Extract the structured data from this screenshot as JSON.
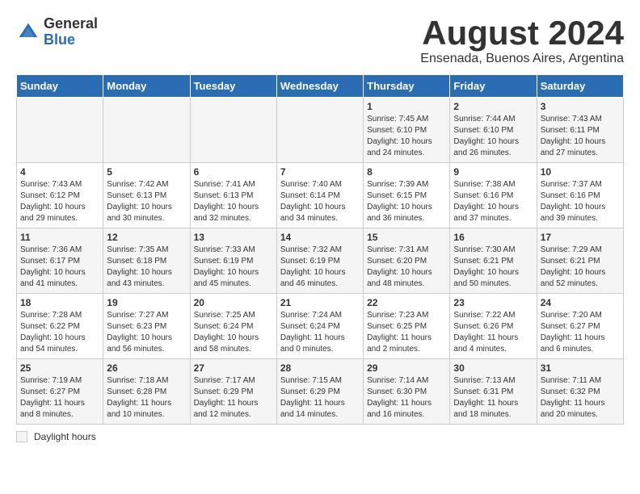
{
  "header": {
    "logo_general": "General",
    "logo_blue": "Blue",
    "month_title": "August 2024",
    "subtitle": "Ensenada, Buenos Aires, Argentina"
  },
  "days_of_week": [
    "Sunday",
    "Monday",
    "Tuesday",
    "Wednesday",
    "Thursday",
    "Friday",
    "Saturday"
  ],
  "weeks": [
    [
      {
        "day": "",
        "content": ""
      },
      {
        "day": "",
        "content": ""
      },
      {
        "day": "",
        "content": ""
      },
      {
        "day": "",
        "content": ""
      },
      {
        "day": "1",
        "content": "Sunrise: 7:45 AM\nSunset: 6:10 PM\nDaylight: 10 hours and 24 minutes."
      },
      {
        "day": "2",
        "content": "Sunrise: 7:44 AM\nSunset: 6:10 PM\nDaylight: 10 hours and 26 minutes."
      },
      {
        "day": "3",
        "content": "Sunrise: 7:43 AM\nSunset: 6:11 PM\nDaylight: 10 hours and 27 minutes."
      }
    ],
    [
      {
        "day": "4",
        "content": "Sunrise: 7:43 AM\nSunset: 6:12 PM\nDaylight: 10 hours and 29 minutes."
      },
      {
        "day": "5",
        "content": "Sunrise: 7:42 AM\nSunset: 6:13 PM\nDaylight: 10 hours and 30 minutes."
      },
      {
        "day": "6",
        "content": "Sunrise: 7:41 AM\nSunset: 6:13 PM\nDaylight: 10 hours and 32 minutes."
      },
      {
        "day": "7",
        "content": "Sunrise: 7:40 AM\nSunset: 6:14 PM\nDaylight: 10 hours and 34 minutes."
      },
      {
        "day": "8",
        "content": "Sunrise: 7:39 AM\nSunset: 6:15 PM\nDaylight: 10 hours and 36 minutes."
      },
      {
        "day": "9",
        "content": "Sunrise: 7:38 AM\nSunset: 6:16 PM\nDaylight: 10 hours and 37 minutes."
      },
      {
        "day": "10",
        "content": "Sunrise: 7:37 AM\nSunset: 6:16 PM\nDaylight: 10 hours and 39 minutes."
      }
    ],
    [
      {
        "day": "11",
        "content": "Sunrise: 7:36 AM\nSunset: 6:17 PM\nDaylight: 10 hours and 41 minutes."
      },
      {
        "day": "12",
        "content": "Sunrise: 7:35 AM\nSunset: 6:18 PM\nDaylight: 10 hours and 43 minutes."
      },
      {
        "day": "13",
        "content": "Sunrise: 7:33 AM\nSunset: 6:19 PM\nDaylight: 10 hours and 45 minutes."
      },
      {
        "day": "14",
        "content": "Sunrise: 7:32 AM\nSunset: 6:19 PM\nDaylight: 10 hours and 46 minutes."
      },
      {
        "day": "15",
        "content": "Sunrise: 7:31 AM\nSunset: 6:20 PM\nDaylight: 10 hours and 48 minutes."
      },
      {
        "day": "16",
        "content": "Sunrise: 7:30 AM\nSunset: 6:21 PM\nDaylight: 10 hours and 50 minutes."
      },
      {
        "day": "17",
        "content": "Sunrise: 7:29 AM\nSunset: 6:21 PM\nDaylight: 10 hours and 52 minutes."
      }
    ],
    [
      {
        "day": "18",
        "content": "Sunrise: 7:28 AM\nSunset: 6:22 PM\nDaylight: 10 hours and 54 minutes."
      },
      {
        "day": "19",
        "content": "Sunrise: 7:27 AM\nSunset: 6:23 PM\nDaylight: 10 hours and 56 minutes."
      },
      {
        "day": "20",
        "content": "Sunrise: 7:25 AM\nSunset: 6:24 PM\nDaylight: 10 hours and 58 minutes."
      },
      {
        "day": "21",
        "content": "Sunrise: 7:24 AM\nSunset: 6:24 PM\nDaylight: 11 hours and 0 minutes."
      },
      {
        "day": "22",
        "content": "Sunrise: 7:23 AM\nSunset: 6:25 PM\nDaylight: 11 hours and 2 minutes."
      },
      {
        "day": "23",
        "content": "Sunrise: 7:22 AM\nSunset: 6:26 PM\nDaylight: 11 hours and 4 minutes."
      },
      {
        "day": "24",
        "content": "Sunrise: 7:20 AM\nSunset: 6:27 PM\nDaylight: 11 hours and 6 minutes."
      }
    ],
    [
      {
        "day": "25",
        "content": "Sunrise: 7:19 AM\nSunset: 6:27 PM\nDaylight: 11 hours and 8 minutes."
      },
      {
        "day": "26",
        "content": "Sunrise: 7:18 AM\nSunset: 6:28 PM\nDaylight: 11 hours and 10 minutes."
      },
      {
        "day": "27",
        "content": "Sunrise: 7:17 AM\nSunset: 6:29 PM\nDaylight: 11 hours and 12 minutes."
      },
      {
        "day": "28",
        "content": "Sunrise: 7:15 AM\nSunset: 6:29 PM\nDaylight: 11 hours and 14 minutes."
      },
      {
        "day": "29",
        "content": "Sunrise: 7:14 AM\nSunset: 6:30 PM\nDaylight: 11 hours and 16 minutes."
      },
      {
        "day": "30",
        "content": "Sunrise: 7:13 AM\nSunset: 6:31 PM\nDaylight: 11 hours and 18 minutes."
      },
      {
        "day": "31",
        "content": "Sunrise: 7:11 AM\nSunset: 6:32 PM\nDaylight: 11 hours and 20 minutes."
      }
    ]
  ],
  "footer": {
    "label": "Daylight hours"
  }
}
